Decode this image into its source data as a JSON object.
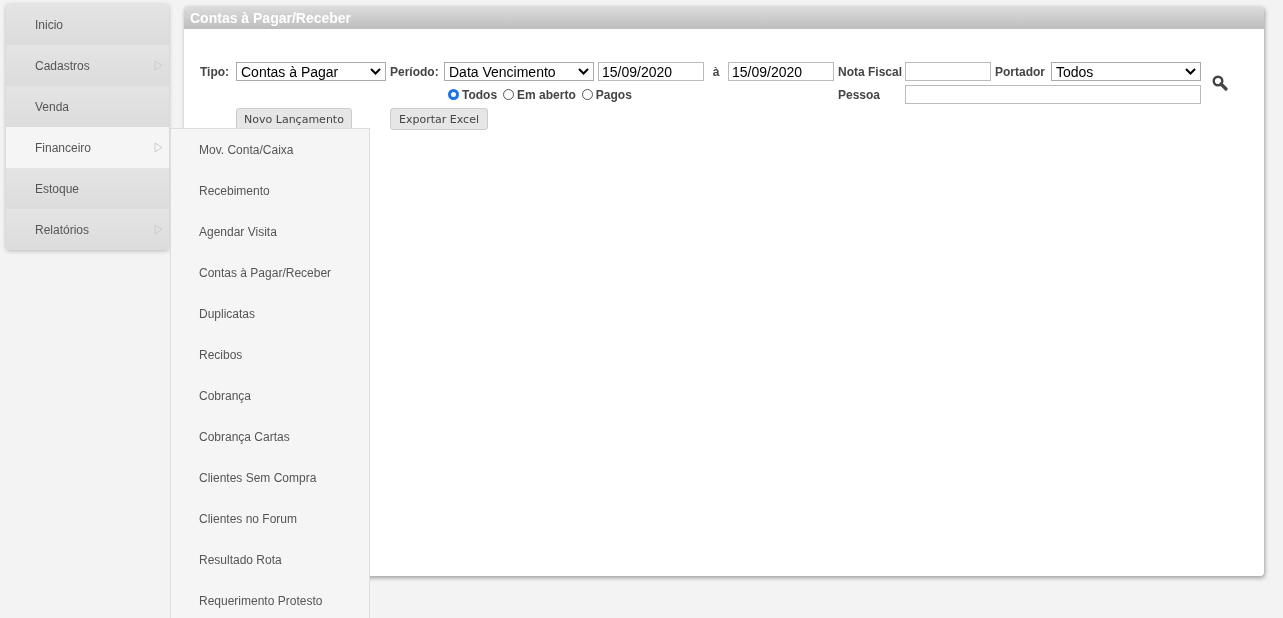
{
  "sidebar": {
    "items": [
      {
        "label": "Inicio",
        "has_submenu": false,
        "selected": false
      },
      {
        "label": "Cadastros",
        "has_submenu": true,
        "selected": false
      },
      {
        "label": "Venda",
        "has_submenu": false,
        "selected": false
      },
      {
        "label": "Financeiro",
        "has_submenu": true,
        "selected": true
      },
      {
        "label": "Estoque",
        "has_submenu": false,
        "selected": false
      },
      {
        "label": "Relatórios",
        "has_submenu": true,
        "selected": false
      }
    ]
  },
  "submenu": {
    "items": [
      "Mov. Conta/Caixa",
      "Recebimento",
      "Agendar Visita",
      "Contas à Pagar/Receber",
      "Duplicatas",
      "Recibos",
      "Cobrança",
      "Cobrança Cartas",
      "Clientes Sem Compra",
      "Clientes no Forum",
      "Resultado Rota",
      "Requerimento Protesto"
    ]
  },
  "panel": {
    "title": "Contas à Pagar/Receber",
    "filters": {
      "tipo": {
        "label": "Tipo:",
        "value": "Contas à Pagar"
      },
      "periodo": {
        "label": "Período:",
        "value": "Data Vencimento"
      },
      "date_from": "15/09/2020",
      "date_separator": "à",
      "date_to": "15/09/2020",
      "nota_fiscal": {
        "label": "Nota Fiscal"
      },
      "portador": {
        "label": "Portador",
        "value": "Todos"
      },
      "pessoa": {
        "label": "Pessoa"
      },
      "status_options": [
        {
          "label": "Todos",
          "selected": true
        },
        {
          "label": "Em aberto",
          "selected": false
        },
        {
          "label": "Pagos",
          "selected": false
        }
      ]
    },
    "buttons": [
      "Novo Lançamento",
      "Exportar Excel"
    ]
  }
}
